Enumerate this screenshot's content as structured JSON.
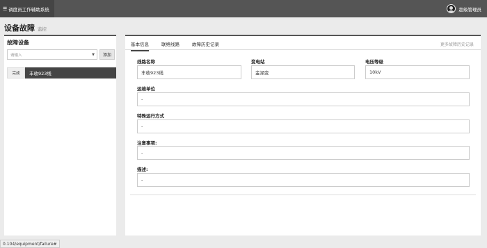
{
  "app": {
    "title": "调度员工作辅助系统",
    "menu_icon": "hamburger-icon"
  },
  "user": {
    "name": "超级管理员",
    "avatar_icon": "user-avatar-icon"
  },
  "page": {
    "title": "设备故障",
    "subtitle": "监控"
  },
  "left_panel": {
    "title": "故障设备",
    "select_placeholder": "请输入",
    "add_label": "添加",
    "items": [
      {
        "status": "完成",
        "name": "丰收923线"
      }
    ]
  },
  "tabs": [
    {
      "label": "基本信息"
    },
    {
      "label": "联络线路"
    },
    {
      "label": "故障历史记录"
    }
  ],
  "more_link": "更多故障历史记录",
  "fields": {
    "line_name": {
      "label": "线路名称",
      "value": "丰收923线"
    },
    "substation": {
      "label": "变电站",
      "value": "金湖变"
    },
    "voltage": {
      "label": "电压等级",
      "value": "10kV"
    },
    "maintenance_unit": {
      "label": "运维单位",
      "value": "-"
    },
    "special_mode": {
      "label": "特殊运行方式",
      "value": "-"
    },
    "notes": {
      "label": "注意事项:",
      "value": "-"
    },
    "description": {
      "label": "描述:",
      "value": "-"
    }
  },
  "status_bar": {
    "url": "0.104/equipment/failure#"
  }
}
